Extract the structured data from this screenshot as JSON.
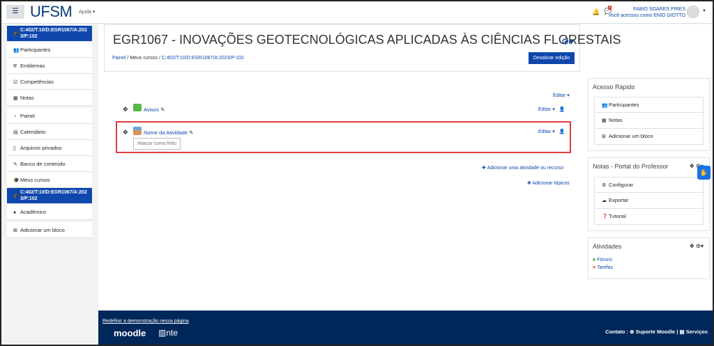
{
  "header": {
    "menu_icon": "hamburger-icon",
    "logo": "UFSM",
    "help": "Ajuda",
    "notifications_count": "2",
    "user_name": "FABIO SOARES PIRES",
    "logged_as": "Você acessou como ENIO GIOTTO"
  },
  "sidebar": {
    "items": [
      {
        "label": "C:402/T:10/D:EGR1067/A:2023/P:102",
        "icon": "graduation-cap-icon",
        "active": true
      },
      {
        "label": "Participantes",
        "icon": "users-icon"
      },
      {
        "label": "Emblemas",
        "icon": "shield-icon"
      },
      {
        "label": "Competências",
        "icon": "checkbox-icon"
      },
      {
        "label": "Notas",
        "icon": "table-icon"
      },
      {
        "label": "Painel",
        "icon": "dashboard-icon"
      },
      {
        "label": "Calendário",
        "icon": "calendar-icon"
      },
      {
        "label": "Arquivos privados",
        "icon": "file-icon"
      },
      {
        "label": "Banco de conteúdo",
        "icon": "brush-icon"
      },
      {
        "label": "Meus cursos",
        "icon": "graduation-cap-icon"
      },
      {
        "label": "C:402/T:10/D:EGR1067/A:2023/P:102",
        "icon": "graduation-cap-icon",
        "active": true
      },
      {
        "label": "Acadêmico",
        "icon": "comment-icon"
      },
      {
        "label": "Adicionar um bloco",
        "icon": "plus-square-icon"
      }
    ]
  },
  "page": {
    "title": "EGR1067 - INOVAÇÕES GEOTECNOLÓGICAS APLICADAS ÀS CIÊNCIAS FLORESTAIS",
    "breadcrumb": [
      "Painel",
      "Meus cursos",
      "C:402/T:10/D:EGR1067/A:2023/P:102"
    ],
    "edit_button": "Desativar edição"
  },
  "course": {
    "section_edit": "Editar",
    "activities": [
      {
        "name": "Avisos",
        "edit": "Editar"
      },
      {
        "name": "Nome da Atividade",
        "edit": "Editar",
        "completion": "Marcar como feito"
      }
    ],
    "add_activity": "Adicionar uma atividade ou recurso",
    "add_topics": "Adicionar tópicos"
  },
  "blocks": {
    "quick": {
      "title": "Acesso Rápido",
      "items": [
        "Participantes",
        "Notas",
        "Adicionar um bloco"
      ]
    },
    "grades": {
      "title": "Notas - Portal do Professor",
      "items": [
        "Configurar",
        "Exportar",
        "Tutorial"
      ]
    },
    "activities": {
      "title": "Atividades",
      "items": [
        "Fóruns",
        "Tarefas"
      ]
    }
  },
  "footer": {
    "reset": "Redefinir a demonstração nessa página",
    "moodle": "moodle",
    "nte": "nte",
    "contact": "Contato :",
    "support": "Suporte Moodle",
    "sep": "|",
    "services": "Serviços"
  }
}
